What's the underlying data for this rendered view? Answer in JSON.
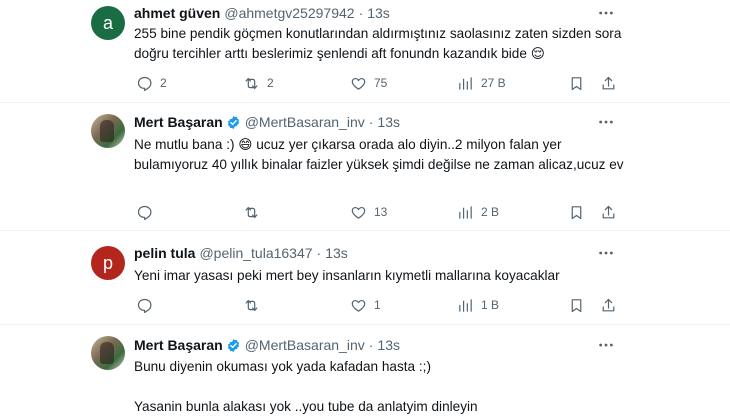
{
  "tweets": [
    {
      "name": "ahmet güven",
      "handle": "@ahmetgv25297942",
      "separator": "·",
      "time": "13s",
      "avatar_letter": "a",
      "avatar_color": "#1a6d43",
      "verified": false,
      "lines": [
        "255 bine pendik göçmen konutlarından aldırmıştınız saolasınız zaten sizden sora doğru tercihler arttı beslerimiz şenlendi aft fonundn kazandık bide 😌"
      ],
      "replies": "2",
      "retweets": "2",
      "likes": "75",
      "views": "27 B"
    },
    {
      "name": "Mert Başaran",
      "handle": "@MertBasaran_inv",
      "separator": "·",
      "time": "13s",
      "avatar_letter": "",
      "avatar_color": "#8a7a62",
      "verified": true,
      "lines": [
        "Ne mutlu bana :) 😄  ucuz yer çıkarsa orada alo diyin..2 milyon falan yer bulamıyoruz 40 yıllık binalar faizler yüksek şimdi değilse ne zaman alicaz,ucuz ev"
      ],
      "replies": "",
      "retweets": "",
      "likes": "13",
      "views": "2 B"
    },
    {
      "name": "pelin tula",
      "handle": "@pelin_tula16347",
      "separator": "·",
      "time": "13s",
      "avatar_letter": "p",
      "avatar_color": "#b3261e",
      "verified": false,
      "lines": [
        "Yeni imar yasası peki mert bey insanların kıymetli mallarına koyacaklar"
      ],
      "replies": "",
      "retweets": "",
      "likes": "1",
      "views": "1 B"
    },
    {
      "name": "Mert Başaran",
      "handle": "@MertBasaran_inv",
      "separator": "·",
      "time": "13s",
      "avatar_letter": "",
      "avatar_color": "#8a7a62",
      "verified": true,
      "lines": [
        "Bunu diyenin okuması yok yada kafadan hasta :;)",
        "Yasanin bunla alakası yok ..you tube da anlatyim dinleyin"
      ]
    }
  ],
  "colors": {
    "verified": "#1d9bf0",
    "muted": "#536471",
    "divider": "#eff3f4"
  },
  "icons": {
    "reply": "reply-icon",
    "retweet": "retweet-icon",
    "like": "heart-icon",
    "views": "views-chart-icon",
    "bookmark": "bookmark-icon",
    "share": "share-icon",
    "more": "more-dots-icon",
    "verified": "verified-badge-icon"
  }
}
